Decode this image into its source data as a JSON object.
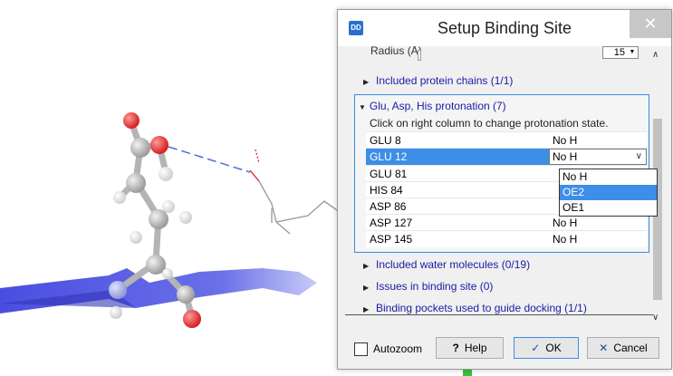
{
  "viewport": {
    "green_accent": "#37c43a"
  },
  "dialog": {
    "app_icon": "DD",
    "title": "Setup Binding Site",
    "close": "✕",
    "radius_label": "Radius (Å)",
    "radius_value": "15",
    "sections": {
      "protein_chains": "Included protein chains (1/1)",
      "protonation": "Glu, Asp, His protonation (7)",
      "water": "Included water molecules (0/19)",
      "issues": "Issues in binding site (0)",
      "pockets": "Binding pockets used to guide docking (1/1)"
    },
    "protonation_instructions": "Click on right column to change protonation state.",
    "residues": [
      {
        "name": "GLU 8",
        "state": "No H"
      },
      {
        "name": "GLU 12",
        "state": "No H"
      },
      {
        "name": "GLU 81",
        "state": ""
      },
      {
        "name": "HIS 84",
        "state": ""
      },
      {
        "name": "ASP 86",
        "state": ""
      },
      {
        "name": "ASP 127",
        "state": "No H"
      },
      {
        "name": "ASP 145",
        "state": "No H"
      }
    ],
    "dropdown_options": [
      "No H",
      "OE2",
      "OE1"
    ],
    "buttons": {
      "autozoom": "Autozoom",
      "help": "Help",
      "help_icon": "?",
      "ok": "OK",
      "ok_icon": "✓",
      "cancel": "Cancel",
      "cancel_icon": "✕"
    },
    "colors": {
      "accent": "#3d8ee6",
      "link": "#1a1aa6"
    }
  }
}
